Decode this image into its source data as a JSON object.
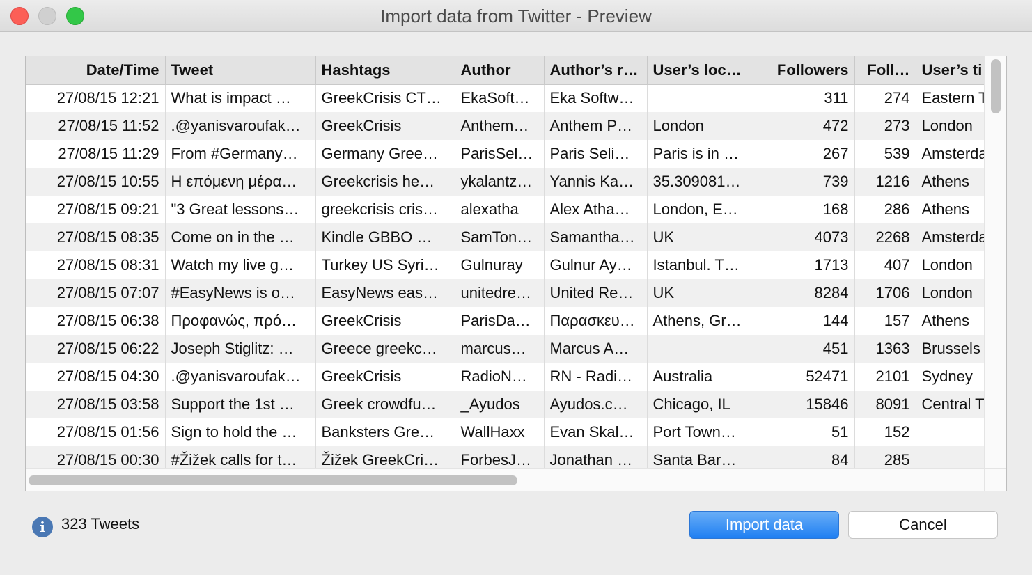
{
  "window": {
    "title": "Import data from Twitter - Preview"
  },
  "table": {
    "columns": [
      "Date/Time",
      "Tweet",
      "Hashtags",
      "Author",
      "Author’s r…",
      "User’s loc…",
      "Followers",
      "Foll…",
      "User’s ti"
    ],
    "rows": [
      [
        "27/08/15 12:21",
        "What is impact …",
        "GreekCrisis CT…",
        "EkaSoft…",
        "Eka Softw…",
        "",
        "311",
        "274",
        "Eastern T"
      ],
      [
        "27/08/15 11:52",
        ".@yanisvaroufak…",
        "GreekCrisis",
        "Anthem…",
        "Anthem P…",
        "London",
        "472",
        "273",
        "London"
      ],
      [
        "27/08/15 11:29",
        "From #Germany…",
        "Germany Gree…",
        "ParisSel…",
        "Paris Seli…",
        "Paris is in …",
        "267",
        "539",
        "Amsterda"
      ],
      [
        "27/08/15 10:55",
        "Η επόμενη μέρα…",
        "Greekcrisis he…",
        "ykalantz…",
        "Yannis Ka…",
        "35.309081…",
        "739",
        "1216",
        "Athens"
      ],
      [
        "27/08/15 09:21",
        "\"3 Great lessons…",
        "greekcrisis cris…",
        "alexatha",
        "Alex Atha…",
        "London, E…",
        "168",
        "286",
        "Athens"
      ],
      [
        "27/08/15 08:35",
        "Come on in the …",
        "Kindle GBBO …",
        "SamTon…",
        "Samantha…",
        "UK",
        "4073",
        "2268",
        "Amsterda"
      ],
      [
        "27/08/15 08:31",
        "Watch my live g…",
        "Turkey US Syri…",
        "Gulnuray",
        "Gulnur Ay…",
        "Istanbul. T…",
        "1713",
        "407",
        "London"
      ],
      [
        "27/08/15 07:07",
        "#EasyNews is o…",
        "EasyNews eas…",
        "unitedre…",
        "United Re…",
        "UK",
        "8284",
        "1706",
        "London"
      ],
      [
        "27/08/15 06:38",
        "Προφανώς, πρό…",
        "GreekCrisis",
        "ParisDa…",
        "Παρασκευ…",
        "Athens, Gr…",
        "144",
        "157",
        "Athens"
      ],
      [
        "27/08/15 06:22",
        "Joseph Stiglitz: …",
        "Greece greekc…",
        "marcus…",
        "Marcus A…",
        "",
        "451",
        "1363",
        "Brussels"
      ],
      [
        "27/08/15 04:30",
        ".@yanisvaroufak…",
        "GreekCrisis",
        "RadioN…",
        "RN - Radi…",
        "Australia",
        "52471",
        "2101",
        "Sydney"
      ],
      [
        "27/08/15 03:58",
        "Support the 1st …",
        "Greek crowdfu…",
        "_Ayudos",
        "Ayudos.c…",
        "Chicago, IL",
        "15846",
        "8091",
        "Central T"
      ],
      [
        "27/08/15 01:56",
        "Sign to hold the …",
        "Banksters Gre…",
        "WallHaxx",
        "Evan Skal…",
        "Port Town…",
        "51",
        "152",
        ""
      ],
      [
        "27/08/15 00:30",
        "#Žižek calls for t…",
        "Žižek GreekCri…",
        "ForbesJ…",
        "Jonathan …",
        "Santa Bar…",
        "84",
        "285",
        ""
      ]
    ]
  },
  "footer": {
    "info_icon": "info-icon",
    "count_text": "323 Tweets",
    "import_label": "Import data",
    "cancel_label": "Cancel"
  },
  "colors": {
    "accent": "#1f7ff2",
    "close": "#fc5f57",
    "maximize": "#33c748"
  }
}
